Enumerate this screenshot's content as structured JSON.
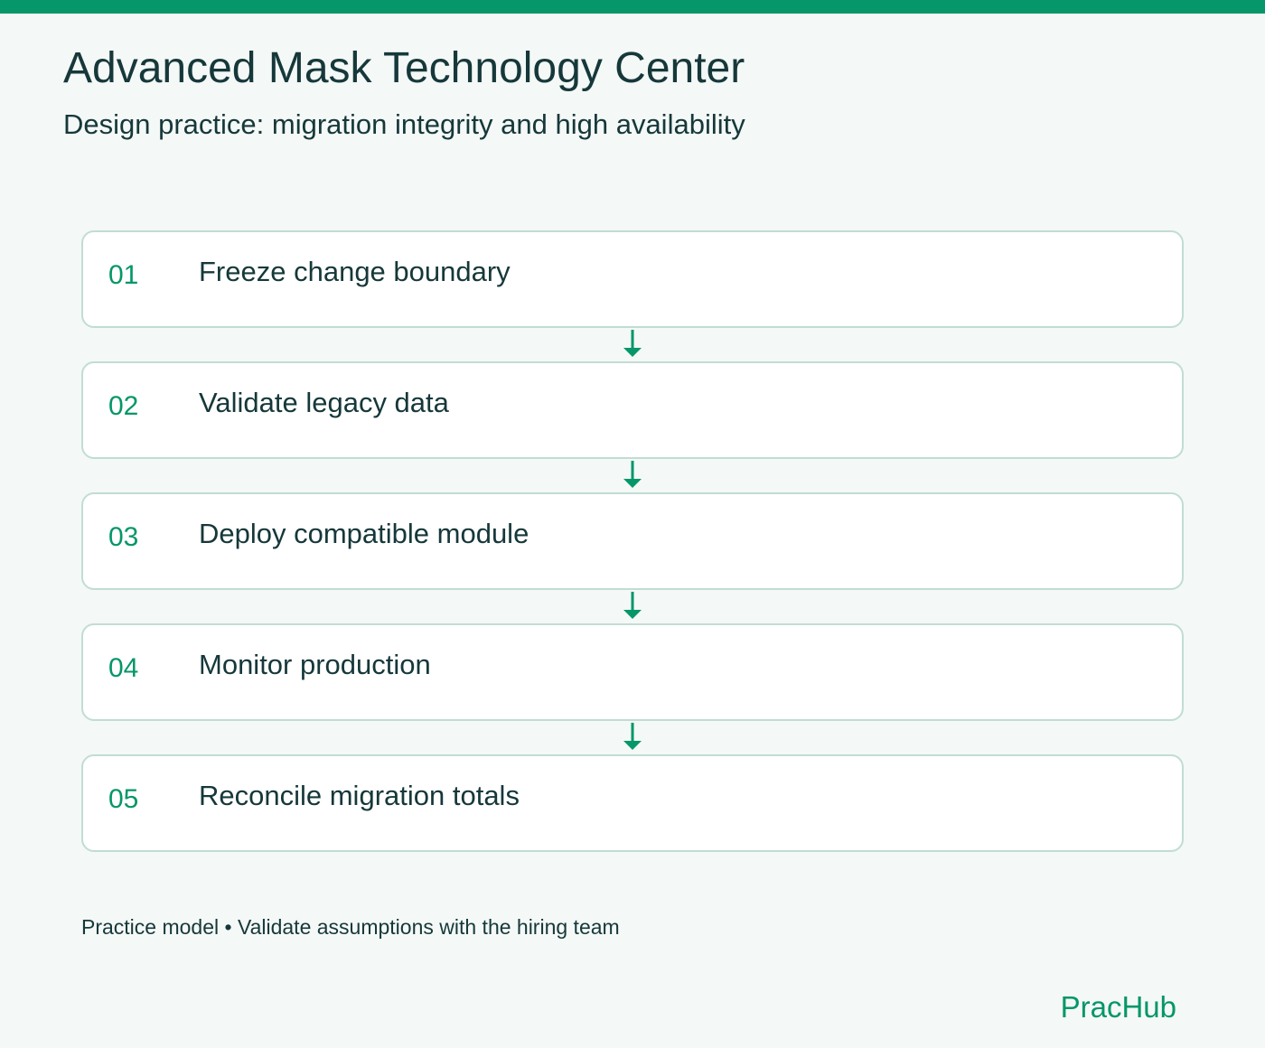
{
  "header": {
    "title": "Advanced Mask Technology Center",
    "subtitle": "Design practice: migration integrity and high availability"
  },
  "steps": [
    {
      "number": "01",
      "label": "Freeze change boundary"
    },
    {
      "number": "02",
      "label": "Validate legacy data"
    },
    {
      "number": "03",
      "label": "Deploy compatible module"
    },
    {
      "number": "04",
      "label": "Monitor production"
    },
    {
      "number": "05",
      "label": "Reconcile migration totals"
    }
  ],
  "footer": {
    "note": "Practice model • Validate assumptions with the hiring team",
    "brand": "PracHub"
  },
  "colors": {
    "accent": "#059669",
    "text": "#16383a",
    "background": "#f4f8f6",
    "card_border": "#c1ddd3",
    "card_background": "#ffffff"
  },
  "icons": {
    "step_connector": "arrow-down-icon"
  }
}
